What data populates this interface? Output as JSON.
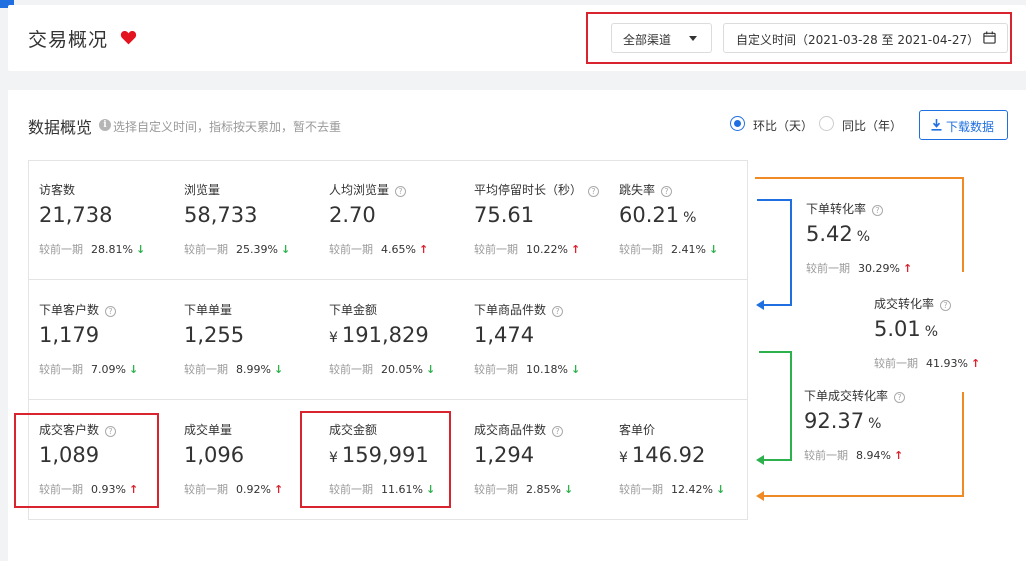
{
  "header": {
    "title": "交易概况",
    "channel": "全部渠道",
    "date_range": "自定义时间（2021-03-28 至 2021-04-27）"
  },
  "overview": {
    "title": "数据概览",
    "hint": "选择自定义时间，指标按天累加，暂不去重",
    "radio_day": "环比（天）",
    "radio_year": "同比（年）",
    "download": "下载数据"
  },
  "compare_label": "较前一期",
  "metrics": [
    {
      "label": "访客数",
      "value": "21,738",
      "pct": "28.81%",
      "trend": "down"
    },
    {
      "label": "浏览量",
      "value": "58,733",
      "pct": "25.39%",
      "trend": "down"
    },
    {
      "label": "人均浏览量",
      "value": "2.70",
      "pct": "4.65%",
      "trend": "up"
    },
    {
      "label": "平均停留时长（秒）",
      "value": "75.61",
      "pct": "10.22%",
      "trend": "up"
    },
    {
      "label": "跳失率",
      "value": "60.21",
      "unit": "%",
      "pct": "2.41%",
      "trend": "down"
    },
    {
      "label": "下单客户数",
      "value": "1,179",
      "pct": "7.09%",
      "trend": "down"
    },
    {
      "label": "下单单量",
      "value": "1,255",
      "pct": "8.99%",
      "trend": "down"
    },
    {
      "label": "下单金额",
      "value": "191,829",
      "currency": "¥",
      "pct": "20.05%",
      "trend": "down"
    },
    {
      "label": "下单商品件数",
      "value": "1,474",
      "pct": "10.18%",
      "trend": "down"
    },
    {
      "label": "成交客户数",
      "value": "1,089",
      "pct": "0.93%",
      "trend": "up"
    },
    {
      "label": "成交单量",
      "value": "1,096",
      "pct": "0.92%",
      "trend": "up"
    },
    {
      "label": "成交金额",
      "value": "159,991",
      "currency": "¥",
      "pct": "11.61%",
      "trend": "down"
    },
    {
      "label": "成交商品件数",
      "value": "1,294",
      "pct": "2.85%",
      "trend": "down"
    },
    {
      "label": "客单价",
      "value": "146.92",
      "currency": "¥",
      "pct": "12.42%",
      "trend": "down"
    }
  ],
  "funnel": [
    {
      "label": "下单转化率",
      "value": "5.42",
      "unit": "%",
      "pct": "30.29%",
      "trend": "up"
    },
    {
      "label": "成交转化率",
      "value": "5.01",
      "unit": "%",
      "pct": "41.93%",
      "trend": "up"
    },
    {
      "label": "下单成交转化率",
      "value": "92.37",
      "unit": "%",
      "pct": "8.94%",
      "trend": "up"
    }
  ],
  "colors": {
    "accent": "#1f6fe0",
    "up": "#d9232e",
    "down": "#2db14d",
    "highlight": "#d9232e",
    "funnel_blue": "#1f6fe0",
    "funnel_orange": "#f08a24",
    "funnel_green": "#2db14d"
  }
}
